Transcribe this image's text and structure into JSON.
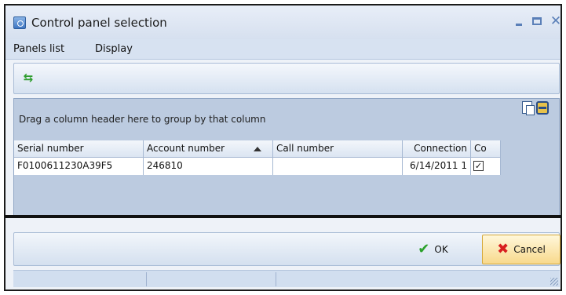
{
  "window": {
    "title": "Control panel selection",
    "min_symbol": "–",
    "max_symbol": "□",
    "close_symbol": "✕"
  },
  "menu": {
    "items": [
      "Panels list",
      "Display"
    ]
  },
  "toolbar": {
    "refresh_icon": "⇆"
  },
  "grid": {
    "group_hint": "Drag a column header here to group by that column",
    "columns": [
      "Serial number",
      "Account number",
      "Call number",
      "Connection",
      "Co"
    ],
    "rows": [
      {
        "serial": "F0100611230A39F5",
        "account": "246810",
        "call": "",
        "connection": "6/14/2011 1",
        "co_checked": true,
        "co_mark": "✓"
      }
    ]
  },
  "footer": {
    "ok_label": "OK",
    "ok_icon": "✔",
    "cancel_label": "Cancel",
    "cancel_icon": "✖"
  },
  "colors": {
    "accent": "#5a7fb8",
    "ok": "#2ba12b",
    "cancel": "#d81f1f"
  }
}
